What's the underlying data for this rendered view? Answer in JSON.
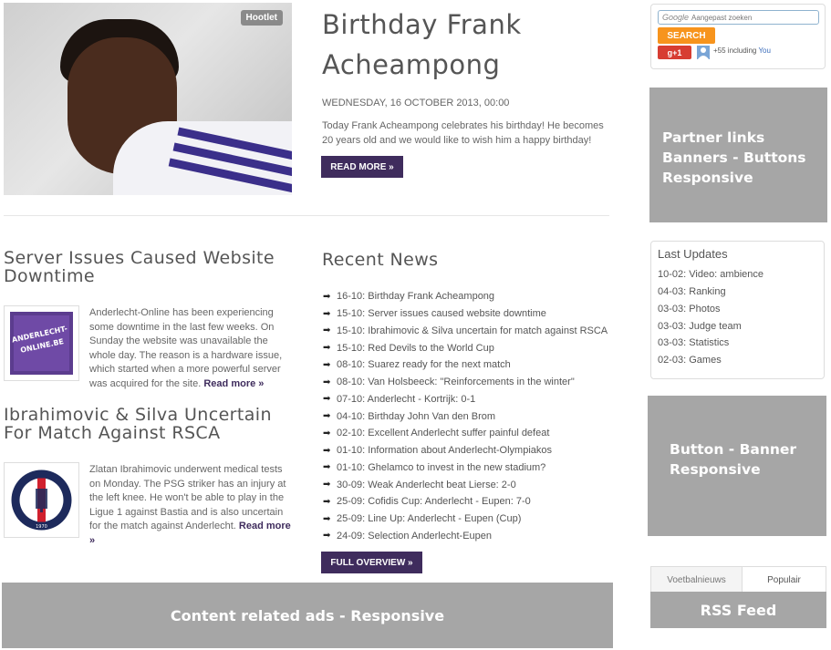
{
  "featured": {
    "badge": "Hootlet",
    "title": "Birthday Frank Acheampong",
    "date": "WEDNESDAY, 16 OCTOBER 2013, 00:00",
    "text": "Today Frank Acheampong celebrates his birthday! He becomes 20 years old and we would like to wish him a happy birthday!",
    "read_more": "READ MORE »"
  },
  "articles": [
    {
      "title": "Server Issues Caused Website Downtime",
      "thumb_label": "ANDERLECHT-ONLINE.BE",
      "text": "Anderlecht-Online has been experiencing some downtime in the last few weeks. On Sunday the website was unavailable the whole day. The reason is a hardware issue, which started when a more powerful server was acquired for the site.",
      "read_more": "Read more »"
    },
    {
      "title": "Ibrahimovic & Silva Uncertain For Match Against RSCA",
      "thumb_label": "PARIS SAINT-GERMAIN",
      "thumb_year": "1970",
      "text": "Zlatan Ibrahimovic underwent medical tests on Monday. The PSG striker has an injury at the left knee. He won't be able to play in the Ligue 1 against Bastia and is also uncertain for the match against Anderlecht.",
      "read_more": "Read more »"
    }
  ],
  "recent_news": {
    "title": "Recent News",
    "items": [
      "16-10: Birthday Frank Acheampong",
      "15-10: Server issues caused website downtime",
      "15-10: Ibrahimovic & Silva uncertain for match against RSCA",
      "15-10: Red Devils to the World Cup",
      "08-10: Suarez ready for the next match",
      "08-10: Van Holsbeeck: \"Reinforcements in the winter\"",
      "07-10: Anderlecht - Kortrijk: 0-1",
      "04-10: Birthday John Van den Brom",
      "02-10: Excellent Anderlecht suffer painful defeat",
      "01-10: Information about Anderlecht-Olympiakos",
      "01-10: Ghelamco to invest in the new stadium?",
      "30-09: Weak Anderlecht beat Lierse: 2-0",
      "25-09: Cofidis Cup: Anderlecht - Eupen: 7-0",
      "25-09: Line Up: Anderlecht - Eupen (Cup)",
      "24-09: Selection Anderlecht-Eupen"
    ],
    "full_overview": "FULL OVERVIEW »"
  },
  "ads": {
    "bottom": "Content related ads - Responsive",
    "partner_lines": [
      "Partner links",
      "Banners - Buttons",
      "Responsive"
    ],
    "button_lines": [
      "Button - Banner",
      "Responsive"
    ],
    "rss": "RSS Feed"
  },
  "search": {
    "brand": "Google",
    "placeholder": "Aangepast zoeken",
    "button": "SEARCH",
    "gplus": "g+1",
    "count_text": "+55 including ",
    "count_you": "You"
  },
  "last_updates": {
    "title": "Last Updates",
    "items": [
      "10-02: Video: ambience",
      "04-03: Ranking",
      "03-03: Photos",
      "03-03: Judge team",
      "03-03: Statistics",
      "02-03: Games"
    ]
  },
  "tabs": [
    "Voetbalnieuws",
    "Populair"
  ],
  "colors": {
    "accent": "#3f2c5d",
    "search_button": "#f7941d",
    "gplus": "#d73d32",
    "ad_gray": "#a6a6a6"
  }
}
